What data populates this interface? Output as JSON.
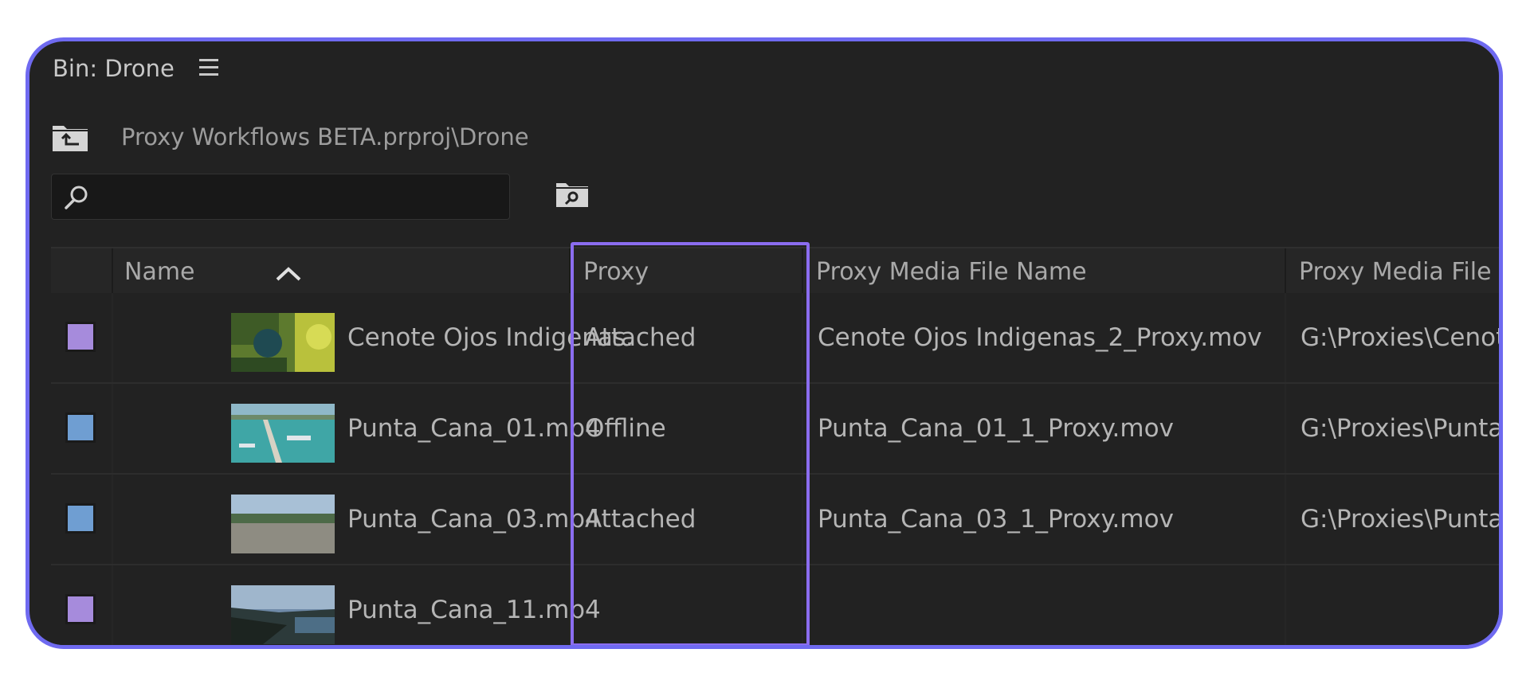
{
  "bin": {
    "title": "Bin: Drone",
    "breadcrumb": "Proxy Workflows BETA.prproj\\Drone"
  },
  "search": {
    "value": "",
    "placeholder": ""
  },
  "icons": {
    "menu": "hamburger-menu-icon",
    "up": "folder-up-icon",
    "search": "search-icon",
    "find": "find-in-folder-icon",
    "sort": "sort-ascending-icon"
  },
  "columns": [
    "Name",
    "Proxy",
    "Proxy Media File Name",
    "Proxy Media File P"
  ],
  "rows": [
    {
      "swatch": "#a68bdc",
      "name": "Cenote Ojos Indigenas.",
      "proxy": "Attached",
      "proxy_file": "Cenote Ojos Indigenas_2_Proxy.mov",
      "proxy_path": "G:\\Proxies\\Cenote"
    },
    {
      "swatch": "#6f9ed2",
      "name": "Punta_Cana_01.mp4",
      "proxy": "Offline",
      "proxy_file": "Punta_Cana_01_1_Proxy.mov",
      "proxy_path": "G:\\Proxies\\Punta_"
    },
    {
      "swatch": "#6f9ed2",
      "name": "Punta_Cana_03.mp4",
      "proxy": "Attached",
      "proxy_file": "Punta_Cana_03_1_Proxy.mov",
      "proxy_path": "G:\\Proxies\\Punta_"
    },
    {
      "swatch": "#a68bdc",
      "name": "Punta_Cana_11.mp4",
      "proxy": "",
      "proxy_file": "",
      "proxy_path": ""
    }
  ],
  "colors": {
    "accent": "#6f6af0",
    "highlight": "#8b6df0",
    "panel": "#222222"
  }
}
